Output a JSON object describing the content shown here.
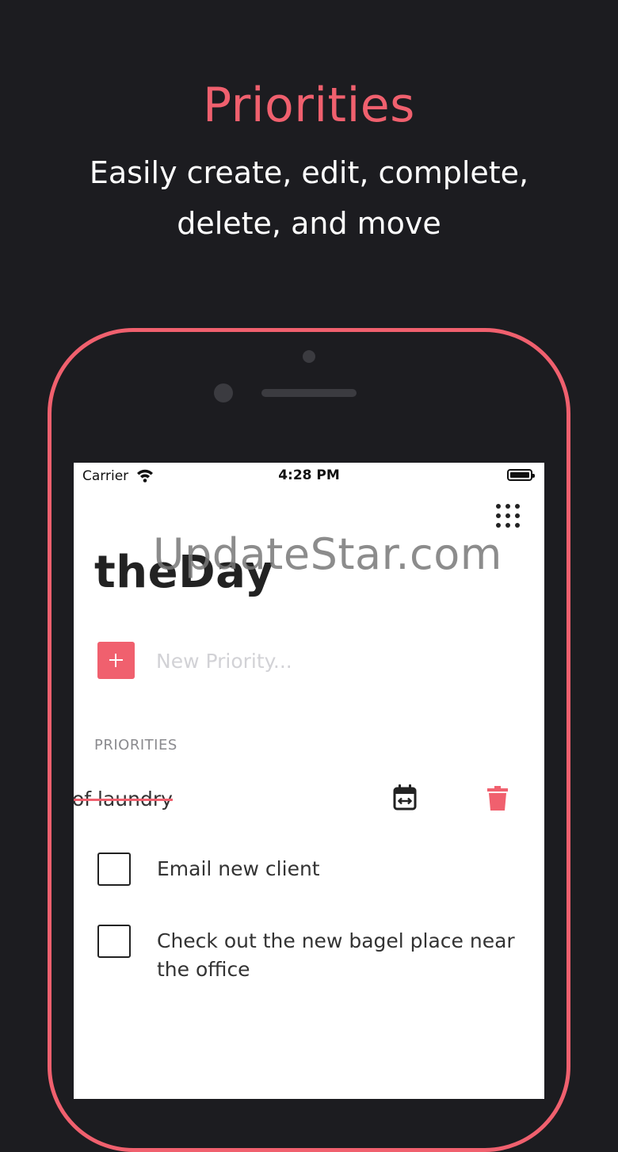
{
  "promo": {
    "headline": "Priorities",
    "subline_1": "Easily create, edit, complete,",
    "subline_2": "delete, and move"
  },
  "status_bar": {
    "carrier": "Carrier",
    "time": "4:28 PM"
  },
  "app": {
    "title": "theDay",
    "watermark": "UpdateStar.com",
    "new_priority_placeholder": "New Priority...",
    "section_label": "PRIORITIES",
    "swiped_item_text": "of laundry",
    "items": [
      {
        "label": "Email new client",
        "checked": false
      },
      {
        "label": "Check out the new bagel place near the office",
        "checked": false
      }
    ]
  },
  "colors": {
    "accent": "#f0606e",
    "background": "#1c1c20",
    "screen": "#ffffff"
  },
  "icons": [
    "wifi-icon",
    "battery-icon",
    "grid-menu-icon",
    "plus-icon",
    "calendar-move-icon",
    "trash-icon"
  ]
}
